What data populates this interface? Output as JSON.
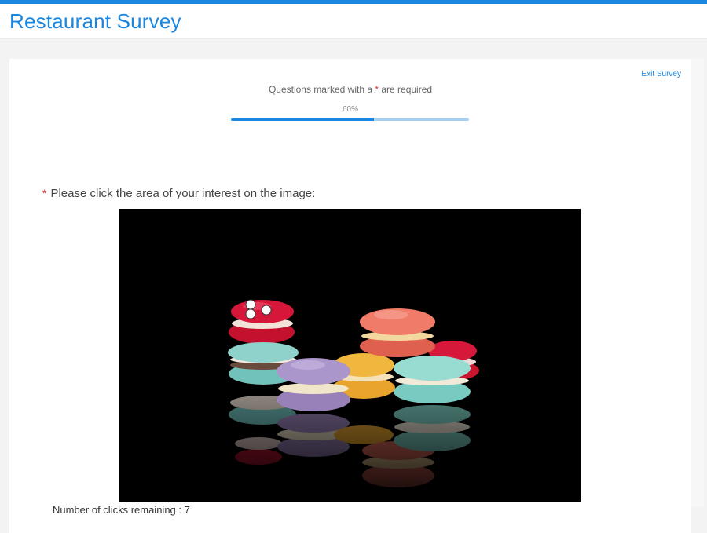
{
  "header": {
    "title": "Restaurant Survey"
  },
  "survey": {
    "exit_label": "Exit Survey",
    "required_note_prefix": "Questions marked with a ",
    "required_star": "*",
    "required_note_suffix": " are required",
    "progress_label": "60%",
    "progress_fraction": 0.6,
    "question_star": "*",
    "question_text": "Please click the area of your interest on the image:",
    "clicks_remaining_text": "Number of clicks remaining : 7"
  },
  "image": {
    "subject": "macarons-on-black-background"
  },
  "colors": {
    "accent": "#1a86e0",
    "required": "#e0302b"
  }
}
